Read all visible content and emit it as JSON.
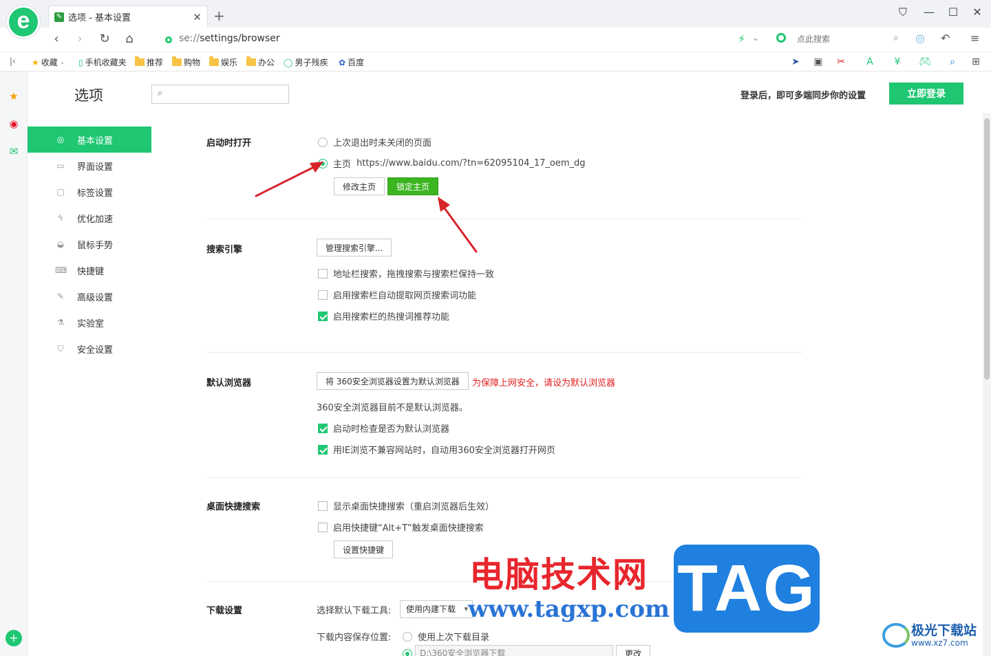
{
  "browser": {
    "logo_letter": "e",
    "tab_title": "选项 - 基本设置",
    "url_scheme": "se://",
    "url_path": "settings/browser",
    "search_placeholder": "点此搜索"
  },
  "bookmarks": [
    {
      "label": "收藏",
      "icon": "star-icon"
    },
    {
      "label": "手机收藏夹",
      "icon": "phone-icon"
    },
    {
      "label": "推荐",
      "icon": "folder-icon"
    },
    {
      "label": "购物",
      "icon": "folder-icon"
    },
    {
      "label": "娱乐",
      "icon": "folder-icon"
    },
    {
      "label": "办公",
      "icon": "folder-icon"
    },
    {
      "label": "男子残疾",
      "icon": "360-icon"
    },
    {
      "label": "百度",
      "icon": "baidu-paw-icon"
    }
  ],
  "page": {
    "title": "选项",
    "sync_text": "登录后，即可多端同步你的设置",
    "login_button": "立即登录"
  },
  "sidebar": {
    "items": [
      {
        "label": "基本设置",
        "icon": "gear-icon",
        "active": true
      },
      {
        "label": "界面设置",
        "icon": "window-icon"
      },
      {
        "label": "标签设置",
        "icon": "tab-icon"
      },
      {
        "label": "优化加速",
        "icon": "lightning-icon"
      },
      {
        "label": "鼠标手势",
        "icon": "mouse-icon"
      },
      {
        "label": "快捷键",
        "icon": "keyboard-icon"
      },
      {
        "label": "高级设置",
        "icon": "wrench-icon"
      },
      {
        "label": "实验室",
        "icon": "flask-icon"
      },
      {
        "label": "安全设置",
        "icon": "shield-icon"
      }
    ]
  },
  "startup": {
    "title": "启动时打开",
    "option_last": "上次退出时未关闭的页面",
    "option_home_label": "主页",
    "option_home_url": "https://www.baidu.com/?tn=62095104_17_oem_dg",
    "modify_button": "修改主页",
    "lock_button": "锁定主页"
  },
  "search_engine": {
    "title": "搜索引擎",
    "manage_button": "管理搜索引擎...",
    "opt1": "地址栏搜索，拖拽搜索与搜索栏保持一致",
    "opt2": "启用搜索栏自动提取网页搜索词功能",
    "opt3": "启用搜索栏的热搜词推荐功能"
  },
  "default_browser": {
    "title": "默认浏览器",
    "set_button": "将 360安全浏览器设置为默认浏览器",
    "warning": "为保障上网安全，请设为默认浏览器",
    "status": "360安全浏览器目前不是默认浏览器。",
    "opt1": "启动时检查是否为默认浏览器",
    "opt2": "用IE浏览不兼容网站时，自动用360安全浏览器打开网页"
  },
  "desktop_search": {
    "title": "桌面快捷搜索",
    "opt1": "显示桌面快捷搜索（重启浏览器后生效）",
    "opt2": "启用快捷键“Alt+T”触发桌面快捷搜索",
    "shortcut_button": "设置快捷键"
  },
  "download": {
    "title": "下载设置",
    "tool_label": "选择默认下载工具:",
    "tool_value": "使用内建下载",
    "location_label": "下载内容保存位置:",
    "opt_last": "使用上次下载目录",
    "path_value": "D:\\360安全浏览器下载",
    "change_button": "更改"
  },
  "watermark": {
    "cn": "电脑技术网",
    "url": "www.tagxp.com",
    "tag": "TAG",
    "jg_title": "极光下载站",
    "jg_url": "www.xz7.com"
  },
  "colors": {
    "accent": "#1fc773",
    "lock_button": "#3cb521",
    "warning": "#e02020",
    "arrow": "#d9232a"
  }
}
